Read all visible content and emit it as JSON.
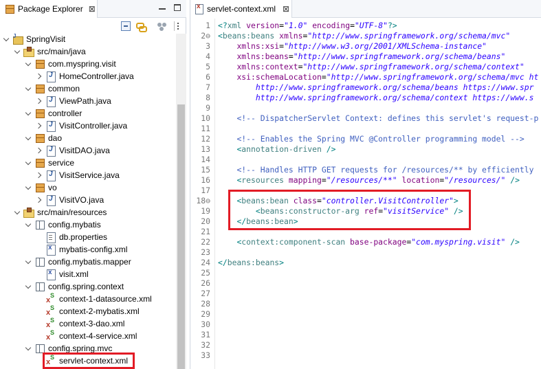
{
  "explorer": {
    "tab_label": "Package Explorer",
    "tab_close": "⊠",
    "tree": [
      {
        "label": "SpringVisit",
        "level": 0,
        "icon": "project-icon",
        "state": "open"
      },
      {
        "label": "src/main/java",
        "level": 1,
        "icon": "source-folder-icon",
        "state": "open"
      },
      {
        "label": "com.myspring.visit",
        "level": 2,
        "icon": "package-icon",
        "state": "open"
      },
      {
        "label": "HomeController.java",
        "level": 3,
        "icon": "java-file-icon",
        "state": "closed"
      },
      {
        "label": "common",
        "level": 2,
        "icon": "package-icon",
        "state": "open"
      },
      {
        "label": "ViewPath.java",
        "level": 3,
        "icon": "java-file-icon",
        "state": "closed"
      },
      {
        "label": "controller",
        "level": 2,
        "icon": "package-icon",
        "state": "open"
      },
      {
        "label": "VisitController.java",
        "level": 3,
        "icon": "java-file-icon",
        "state": "closed"
      },
      {
        "label": "dao",
        "level": 2,
        "icon": "package-icon",
        "state": "open"
      },
      {
        "label": "VisitDAO.java",
        "level": 3,
        "icon": "java-file-icon",
        "state": "closed"
      },
      {
        "label": "service",
        "level": 2,
        "icon": "package-icon",
        "state": "open"
      },
      {
        "label": "VisitService.java",
        "level": 3,
        "icon": "java-file-icon",
        "state": "closed"
      },
      {
        "label": "vo",
        "level": 2,
        "icon": "package-icon",
        "state": "open"
      },
      {
        "label": "VisitVO.java",
        "level": 3,
        "icon": "java-file-icon",
        "state": "closed"
      },
      {
        "label": "src/main/resources",
        "level": 1,
        "icon": "source-folder-icon",
        "state": "open"
      },
      {
        "label": "config.mybatis",
        "level": 2,
        "icon": "resource-package-icon",
        "state": "open"
      },
      {
        "label": "db.properties",
        "level": 3,
        "icon": "properties-file-icon",
        "state": "none"
      },
      {
        "label": "mybatis-config.xml",
        "level": 3,
        "icon": "xml-file-icon",
        "state": "none"
      },
      {
        "label": "config.mybatis.mapper",
        "level": 2,
        "icon": "resource-package-icon",
        "state": "open"
      },
      {
        "label": "visit.xml",
        "level": 3,
        "icon": "xml-file-icon",
        "state": "none"
      },
      {
        "label": "config.spring.context",
        "level": 2,
        "icon": "resource-package-icon",
        "state": "open"
      },
      {
        "label": "context-1-datasource.xml",
        "level": 3,
        "icon": "spring-xml-icon",
        "state": "none"
      },
      {
        "label": "context-2-mybatis.xml",
        "level": 3,
        "icon": "spring-xml-icon",
        "state": "none"
      },
      {
        "label": "context-3-dao.xml",
        "level": 3,
        "icon": "spring-xml-icon",
        "state": "none"
      },
      {
        "label": "context-4-service.xml",
        "level": 3,
        "icon": "spring-xml-icon",
        "state": "none"
      },
      {
        "label": "config.spring.mvc",
        "level": 2,
        "icon": "resource-package-icon",
        "state": "open"
      },
      {
        "label": "servlet-context.xml",
        "level": 3,
        "icon": "spring-xml-icon",
        "state": "none"
      }
    ]
  },
  "editor": {
    "tab_label": "servlet-context.xml",
    "tab_close": "⊠",
    "line_numbers": [
      "1",
      "2⊖",
      "3",
      "4",
      "5",
      "6",
      "7",
      "8",
      "9",
      "10",
      "11",
      "12",
      "13",
      "14",
      "15",
      "16",
      "17",
      "18⊖",
      "19",
      "20",
      "21",
      "22",
      "23",
      "24",
      "25",
      "26",
      "27",
      "28",
      "29",
      "30",
      "31",
      "32",
      "33"
    ],
    "lines": [
      [
        [
          "punc",
          "<?"
        ],
        [
          "tag",
          "xml "
        ],
        [
          "attr",
          "version"
        ],
        [
          "plain",
          "="
        ],
        [
          "val",
          "\"1.0\""
        ],
        [
          "plain",
          " "
        ],
        [
          "attr",
          "encoding"
        ],
        [
          "plain",
          "="
        ],
        [
          "val",
          "\"UTF-8\""
        ],
        [
          "punc",
          "?>"
        ]
      ],
      [
        [
          "punc",
          "<"
        ],
        [
          "tag",
          "beans:beans "
        ],
        [
          "attr",
          "xmlns"
        ],
        [
          "plain",
          "="
        ],
        [
          "val",
          "\"http://www.springframework.org/schema/mvc\""
        ]
      ],
      [
        [
          "plain",
          "    "
        ],
        [
          "attr",
          "xmlns:xsi"
        ],
        [
          "plain",
          "="
        ],
        [
          "val",
          "\"http://www.w3.org/2001/XMLSchema-instance\""
        ]
      ],
      [
        [
          "plain",
          "    "
        ],
        [
          "attr",
          "xmlns:beans"
        ],
        [
          "plain",
          "="
        ],
        [
          "val",
          "\"http://www.springframework.org/schema/beans\""
        ]
      ],
      [
        [
          "plain",
          "    "
        ],
        [
          "attr",
          "xmlns:context"
        ],
        [
          "plain",
          "="
        ],
        [
          "val",
          "\"http://www.springframework.org/schema/context\""
        ]
      ],
      [
        [
          "plain",
          "    "
        ],
        [
          "attr",
          "xsi:schemaLocation"
        ],
        [
          "plain",
          "="
        ],
        [
          "val",
          "\"http://www.springframework.org/schema/mvc ht"
        ]
      ],
      [
        [
          "plain",
          "        "
        ],
        [
          "val",
          "http://www.springframework.org/schema/beans https://www.spr"
        ]
      ],
      [
        [
          "plain",
          "        "
        ],
        [
          "val",
          "http://www.springframework.org/schema/context https://www.s"
        ]
      ],
      [],
      [
        [
          "plain",
          "    "
        ],
        [
          "cmt",
          "<!-- DispatcherServlet Context: defines this servlet's request-p"
        ]
      ],
      [],
      [
        [
          "plain",
          "    "
        ],
        [
          "cmt",
          "<!-- Enables the Spring MVC @Controller programming model -->"
        ]
      ],
      [
        [
          "plain",
          "    "
        ],
        [
          "punc",
          "<"
        ],
        [
          "tag",
          "annotation-driven "
        ],
        [
          "punc",
          "/>"
        ]
      ],
      [],
      [
        [
          "plain",
          "    "
        ],
        [
          "cmt",
          "<!-- Handles HTTP GET requests for /resources/** by efficiently"
        ]
      ],
      [
        [
          "plain",
          "    "
        ],
        [
          "punc",
          "<"
        ],
        [
          "tag",
          "resources "
        ],
        [
          "attr",
          "mapping"
        ],
        [
          "plain",
          "="
        ],
        [
          "val",
          "\"/resources/**\""
        ],
        [
          "plain",
          " "
        ],
        [
          "attr",
          "location"
        ],
        [
          "plain",
          "="
        ],
        [
          "val",
          "\"/resources/\""
        ],
        [
          "plain",
          " "
        ],
        [
          "punc",
          "/>"
        ]
      ],
      [],
      [
        [
          "plain",
          "    "
        ],
        [
          "punc",
          "<"
        ],
        [
          "tag",
          "beans:bean "
        ],
        [
          "attr",
          "class"
        ],
        [
          "plain",
          "="
        ],
        [
          "val",
          "\"controller.VisitController\""
        ],
        [
          "punc",
          ">"
        ]
      ],
      [
        [
          "plain",
          "        "
        ],
        [
          "punc",
          "<"
        ],
        [
          "tag",
          "beans:constructor-arg "
        ],
        [
          "attr",
          "ref"
        ],
        [
          "plain",
          "="
        ],
        [
          "val",
          "\"visitService\""
        ],
        [
          "plain",
          " "
        ],
        [
          "punc",
          "/>"
        ]
      ],
      [
        [
          "plain",
          "    "
        ],
        [
          "punc",
          "</"
        ],
        [
          "tag",
          "beans:bean"
        ],
        [
          "punc",
          ">"
        ]
      ],
      [],
      [
        [
          "plain",
          "    "
        ],
        [
          "punc",
          "<"
        ],
        [
          "tag",
          "context:component-scan "
        ],
        [
          "attr",
          "base-package"
        ],
        [
          "plain",
          "="
        ],
        [
          "val",
          "\"com.myspring.visit\""
        ],
        [
          "plain",
          " "
        ],
        [
          "punc",
          "/>"
        ]
      ],
      [],
      [
        [
          "punc",
          "</"
        ],
        [
          "tag",
          "beans:beans"
        ],
        [
          "punc",
          ">"
        ]
      ],
      [],
      [],
      [],
      [],
      [],
      [],
      [],
      [],
      []
    ]
  }
}
